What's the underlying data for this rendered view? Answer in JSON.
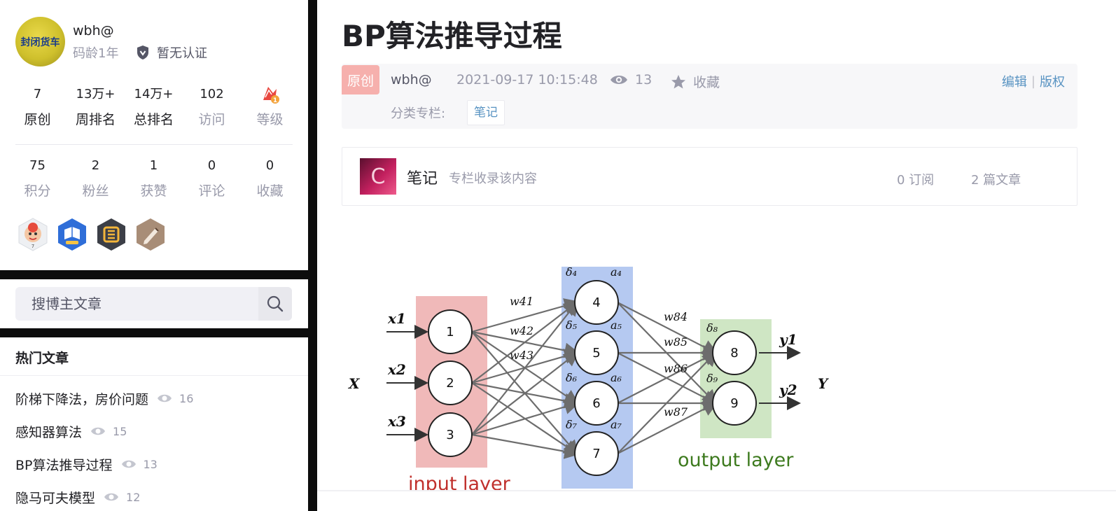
{
  "sidebar": {
    "profile": {
      "avatar_text": "封闭货车",
      "username": "wbh@",
      "code_age": "码龄1年",
      "cert": "暂无认证",
      "stats_row1": [
        {
          "num": "7",
          "label": "原创"
        },
        {
          "num": "13万+",
          "label": "周排名"
        },
        {
          "num": "14万+",
          "label": "总排名"
        },
        {
          "num": "102",
          "label": "访问"
        },
        {
          "num": "",
          "label": "等级"
        }
      ],
      "stats_row2": [
        {
          "num": "75",
          "label": "积分"
        },
        {
          "num": "2",
          "label": "粉丝"
        },
        {
          "num": "1",
          "label": "获赞"
        },
        {
          "num": "0",
          "label": "评论"
        },
        {
          "num": "0",
          "label": "收藏"
        }
      ]
    },
    "search": {
      "placeholder": "搜博主文章"
    },
    "hot": {
      "title": "热门文章",
      "items": [
        {
          "title": "阶梯下降法，房价问题",
          "views": "16"
        },
        {
          "title": "感知器算法",
          "views": "15"
        },
        {
          "title": "BP算法推导过程",
          "views": "13"
        },
        {
          "title": "隐马可夫模型",
          "views": "12"
        }
      ]
    }
  },
  "article": {
    "title": "BP算法推导过程",
    "meta": {
      "tag": "原创",
      "author": "wbh@",
      "date": "2021-09-17 10:15:48",
      "views": "13",
      "favorite": "收藏",
      "edit": "编辑",
      "separator": "|",
      "copyright": "版权",
      "category_label": "分类专栏:",
      "category": "笔记"
    },
    "column": {
      "name": "笔记",
      "desc": "专栏收录该内容",
      "subscriptions": "0 订阅",
      "articles": "2 篇文章"
    }
  },
  "figure": {
    "X": "X",
    "Y": "Y",
    "inputs": [
      "x1",
      "x2",
      "x3"
    ],
    "input_nodes": [
      "1",
      "2",
      "3"
    ],
    "hidden_nodes": [
      "4",
      "5",
      "6",
      "7"
    ],
    "output_nodes": [
      "8",
      "9"
    ],
    "outputs": [
      "y1",
      "y2"
    ],
    "input_layer_label": "input layer",
    "output_layer_label": "output layer",
    "weights_hidden": [
      "w41",
      "w42",
      "w43"
    ],
    "weights_output": [
      "w84",
      "w85",
      "w86",
      "w87"
    ],
    "colors": {
      "input_layer": "#f0b9b9",
      "hidden_layer": "#b5c9f1",
      "output_layer": "#cfe6c4",
      "input_label": "#c0302c",
      "output_label": "#3d7a1e"
    }
  }
}
